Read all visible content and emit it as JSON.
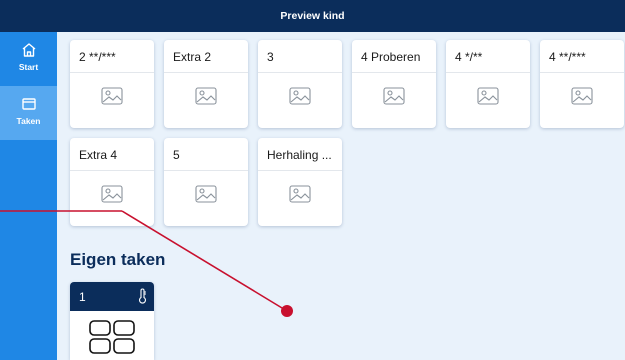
{
  "header": {
    "title": "Preview kind"
  },
  "sidebar": {
    "items": [
      {
        "label": "Start",
        "icon": "home-icon",
        "active": false
      },
      {
        "label": "Taken",
        "icon": "window-icon",
        "active": true
      }
    ]
  },
  "tasks": {
    "row1": [
      "2 **/***",
      "Extra 2",
      "3",
      "4 Proberen",
      "4 */**",
      "4 **/***"
    ],
    "row2": [
      "Extra 4",
      "5",
      "Herhaling ..."
    ]
  },
  "own_tasks": {
    "heading": "Eigen taken",
    "items": [
      {
        "title": "1",
        "icons": [
          "thermometer-icon",
          "grid-layout-icon"
        ]
      }
    ]
  },
  "colors": {
    "header": "#0b2d5b",
    "sidebar": "#1f87e5",
    "sidebar_active": "#56a8f0",
    "background": "#e9f2fb",
    "annotation": "#c8102e"
  }
}
